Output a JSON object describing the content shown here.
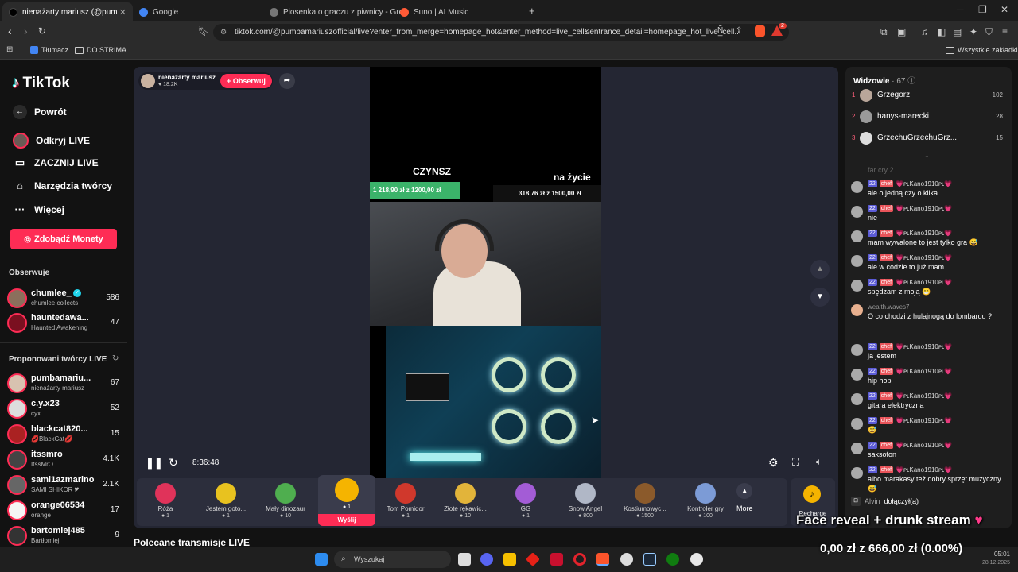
{
  "browser": {
    "tabs": [
      {
        "title": "nienażarty mariusz (@pumbama",
        "active": true,
        "color": "#000"
      },
      {
        "title": "Google",
        "active": false,
        "color": "#4285f4"
      },
      {
        "title": "Piosenka o graczu z piwnicy - Grok",
        "active": false,
        "color": "#888"
      },
      {
        "title": "Suno | AI Music",
        "active": false,
        "color": "#ff5a36"
      }
    ],
    "new_tab": "+",
    "url": "tiktok.com/@pumbamariuszofficial/live?enter_from_merge=homepage_hot&enter_method=live_cell&entrance_detail=homepage_hot_live_cell...",
    "bookmarks": [
      {
        "label": "Tłumacz"
      },
      {
        "label": "DO STRIMA"
      }
    ],
    "all_bookmarks": "Wszystkie zakładki",
    "ext_badge": "2"
  },
  "sidebar": {
    "logo": "TikTok",
    "nav": [
      {
        "label": "Powrót",
        "icon": "arrow-left-icon"
      },
      {
        "label": "Odkryj LIVE",
        "icon": "live-avatar-icon"
      },
      {
        "label": "ZACZNIJ LIVE",
        "icon": "camera-icon"
      },
      {
        "label": "Narzędzia twórcy",
        "icon": "home-icon"
      },
      {
        "label": "Więcej",
        "icon": "more-icon"
      }
    ],
    "coins_button": "Zdobądź Monety",
    "following_title": "Obserwuje",
    "following": [
      {
        "name": "chumlee_",
        "sub": "chumlee collects",
        "count": "586",
        "color": "#8b6f5c",
        "verified": true
      },
      {
        "name": "hauntedawa...",
        "sub": "Haunted Awakening",
        "count": "47",
        "color": "#7a1020"
      }
    ],
    "suggested_title": "Proponowani twórcy LIVE",
    "suggested": [
      {
        "name": "pumbamariu...",
        "sub": "nienażarty mariusz",
        "count": "67",
        "color": "#d8c2b0"
      },
      {
        "name": "c.y.x23",
        "sub": "cyx",
        "count": "52",
        "color": "#ddd"
      },
      {
        "name": "blackcat820...",
        "sub": "💋BlackCat💋",
        "count": "15",
        "color": "#a22"
      },
      {
        "name": "itssmro",
        "sub": "ItssMrO",
        "count": "4.1K",
        "color": "#444"
      },
      {
        "name": "sami1azmarino",
        "sub": "SAMI SHIKOR 🎔",
        "count": "2.1K",
        "color": "#666"
      },
      {
        "name": "orange06534",
        "sub": "orange",
        "count": "17",
        "color": "#f5f5f5"
      },
      {
        "name": "bartomiej485",
        "sub": "Bartłomiej",
        "count": "9",
        "color": "#333"
      }
    ]
  },
  "player": {
    "host_name": "nienażarty mariusz",
    "host_likes": "18.2K",
    "follow_button": "+ Obserwuj",
    "overlay": {
      "czynsz_label": "CZYNSZ",
      "czynsz_progress": "1 218,90 zł z 1200,00 zł",
      "zycie_label": "na życie",
      "zycie_progress": "318,76 zł z 1500,00 zł"
    },
    "time": "8:36:48",
    "gifts": [
      {
        "name": "Róża",
        "price": "1",
        "color": "#e0335a"
      },
      {
        "name": "Jestem goto...",
        "price": "1",
        "color": "#e8c21f"
      },
      {
        "name": "Mały dinozaur",
        "price": "10",
        "color": "#4fae4f"
      },
      {
        "name": "",
        "price": "1",
        "color": "#f5b400"
      },
      {
        "name": "Tom Pomidor",
        "price": "1",
        "color": "#d0382c"
      },
      {
        "name": "Złote rękawic...",
        "price": "10",
        "color": "#e2b43a"
      },
      {
        "name": "GG",
        "price": "1",
        "color": "#a35cd6"
      },
      {
        "name": "Snow Angel",
        "price": "800",
        "color": "#b0b7c6"
      },
      {
        "name": "Kostiumowyc...",
        "price": "1500",
        "color": "#8b5a2b"
      },
      {
        "name": "Kontroler gry",
        "price": "100",
        "color": "#7c9bd6"
      }
    ],
    "send_button": "Wyślij",
    "more_label": "More",
    "recharge_label": "Recharge"
  },
  "viewers": {
    "title": "Widzowie",
    "count": "67",
    "list": [
      {
        "rank": "1",
        "name": "Grzegorz",
        "score": "102"
      },
      {
        "rank": "2",
        "name": "hanys-marecki",
        "score": "28"
      },
      {
        "rank": "3",
        "name": "GrzechuGrzechuGrz...",
        "score": "15"
      }
    ]
  },
  "chat": {
    "faded_text": "far cry 2",
    "messages": [
      {
        "badge_lvl": "22",
        "badge_tag": "chef",
        "user": "💗ᴘʟKano1910ᴘʟ💗",
        "text": "ale o jedną czy o kilka",
        "has_badges": true
      },
      {
        "badge_lvl": "22",
        "badge_tag": "chef",
        "user": "💗ᴘʟKano1910ᴘʟ💗",
        "text": "nie",
        "has_badges": true
      },
      {
        "badge_lvl": "22",
        "badge_tag": "chef",
        "user": "💗ᴘʟKano1910ᴘʟ💗",
        "text": "mam wywalone to jest tylko gra 😅",
        "has_badges": true
      },
      {
        "badge_lvl": "22",
        "badge_tag": "chef",
        "user": "💗ᴘʟKano1910ᴘʟ💗",
        "text": "ale w codzie to już mam",
        "has_badges": true
      },
      {
        "badge_lvl": "22",
        "badge_tag": "chef",
        "user": "💗ᴘʟKano1910ᴘʟ💗",
        "text": "spędzam z moją 😁",
        "has_badges": true
      },
      {
        "badge_lvl": "",
        "badge_tag": "",
        "user": "wealth.waves7",
        "text": "O co chodzi z hulajnogą do lombardu ?",
        "has_badges": false
      },
      {
        "badge_lvl": "22",
        "badge_tag": "chef",
        "user": "💗ᴘʟKano1910ᴘʟ💗",
        "text": "ja jestem",
        "has_badges": true
      },
      {
        "badge_lvl": "22",
        "badge_tag": "chef",
        "user": "💗ᴘʟKano1910ᴘʟ💗",
        "text": "hip hop",
        "has_badges": true
      },
      {
        "badge_lvl": "22",
        "badge_tag": "chef",
        "user": "💗ᴘʟKano1910ᴘʟ💗",
        "text": "gitara elektryczna",
        "has_badges": true
      },
      {
        "badge_lvl": "22",
        "badge_tag": "chef",
        "user": "💗ᴘʟKano1910ᴘʟ💗",
        "text": "😅",
        "has_badges": true
      },
      {
        "badge_lvl": "22",
        "badge_tag": "chef",
        "user": "💗ᴘʟKano1910ᴘʟ💗",
        "text": "saksofon",
        "has_badges": true
      },
      {
        "badge_lvl": "22",
        "badge_tag": "chef",
        "user": "💗ᴘʟKano1910ᴘʟ💗",
        "text": "albo marakasy też dobry sprzęt muzyczny 😅",
        "has_badges": true
      }
    ],
    "join_user": "Alvin",
    "join_text": "dołączył(a)"
  },
  "stream_overlay": {
    "title": "Face reveal + drunk stream",
    "goal": "0,00 zł z 666,00 zł (0.00%)"
  },
  "page_below": {
    "title": "Polecane transmisje LIVE"
  },
  "taskbar": {
    "search": "Wyszukaj",
    "time": "05:01",
    "date": "28.12.2025"
  }
}
